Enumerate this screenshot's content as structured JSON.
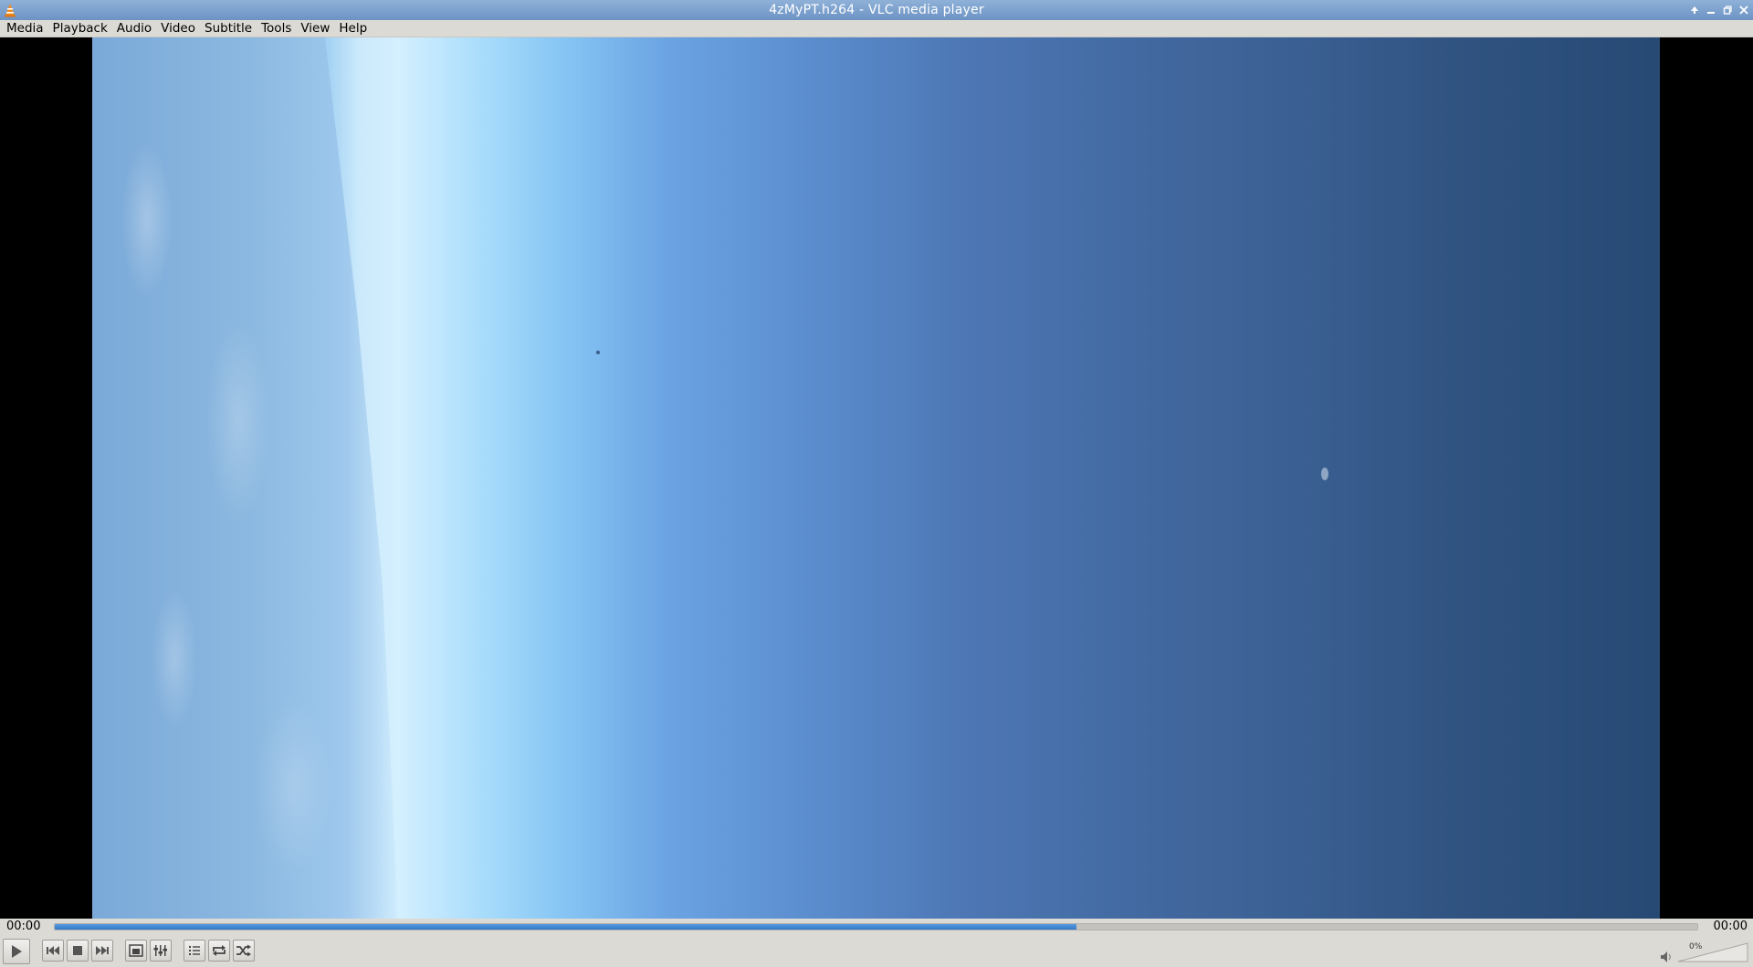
{
  "window": {
    "title": "4zMyPT.h264 - VLC media player",
    "app_icon": "vlc-cone-icon",
    "controls": [
      "up-arrow-icon",
      "minimize-icon",
      "maximize-icon",
      "close-icon"
    ]
  },
  "menu": {
    "items": [
      {
        "label": "Media",
        "key": "M"
      },
      {
        "label": "Playback",
        "key": "l"
      },
      {
        "label": "Audio",
        "key": "A"
      },
      {
        "label": "Video",
        "key": "V"
      },
      {
        "label": "Subtitle",
        "key": "t"
      },
      {
        "label": "Tools",
        "key": "S"
      },
      {
        "label": "View",
        "key": "i"
      },
      {
        "label": "Help",
        "key": "H"
      }
    ]
  },
  "seek": {
    "elapsed": "00:00",
    "total": "00:00",
    "progress_fraction": 0.622,
    "fill_color": "#2f77c8"
  },
  "controls": {
    "buttons": [
      "play-icon",
      "previous-icon",
      "stop-icon",
      "next-icon",
      "fullscreen-icon",
      "extended-settings-icon",
      "playlist-icon",
      "loop-icon",
      "shuffle-icon"
    ]
  },
  "volume": {
    "percent": "0%",
    "level_fraction": 0.0,
    "icon": "speaker-icon"
  }
}
